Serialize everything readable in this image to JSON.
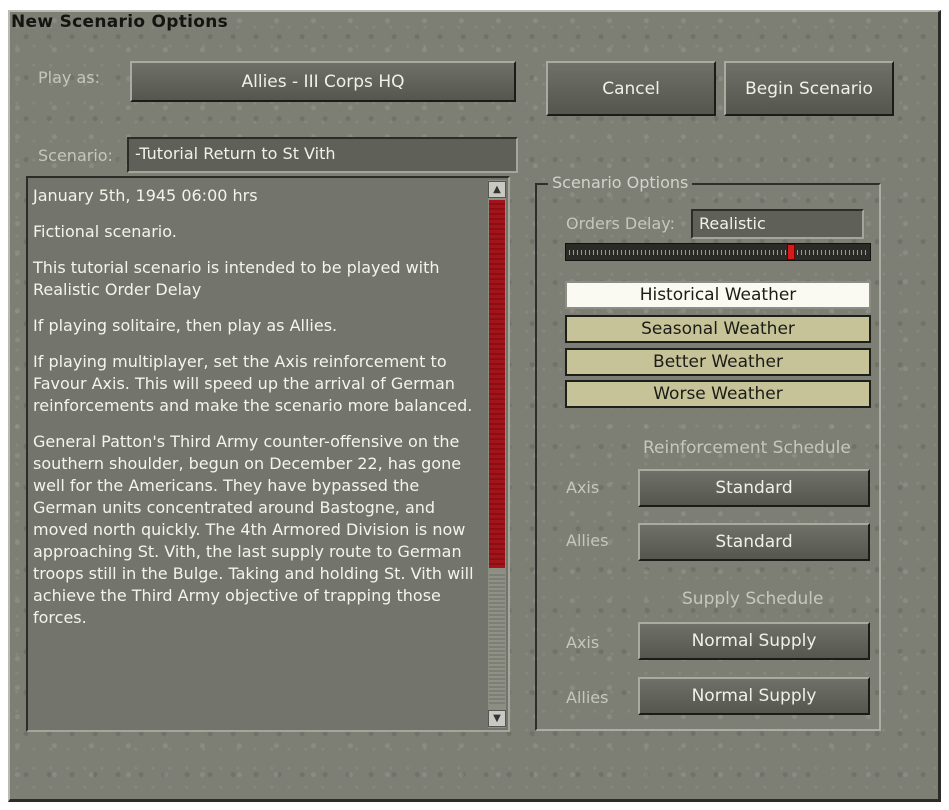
{
  "dialog": {
    "title": "New Scenario Options",
    "play_as_label": "Play as:",
    "play_as_value": "Allies - III Corps HQ",
    "cancel_label": "Cancel",
    "begin_label": "Begin Scenario",
    "scenario_label": "Scenario:",
    "scenario_value": "-Tutorial Return to St Vith"
  },
  "description": {
    "paragraphs": [
      "January 5th, 1945 06:00 hrs",
      "Fictional scenario.",
      "This tutorial scenario is intended to be played with Realistic Order Delay",
      "If playing solitaire, then play as Allies.",
      "If playing multiplayer, set the Axis reinforcement to Favour Axis. This will speed up the arrival of German reinforcements and make the scenario more balanced.",
      "General Patton's Third Army counter-offensive on the southern shoulder, begun on December 22, has gone well for the Americans. They have bypassed the German units concentrated around Bastogne, and moved north quickly. The 4th Armored Division is now approaching St. Vith, the last supply route to German troops still in the Bulge. Taking and holding St. Vith will achieve the Third Army objective of trapping those forces."
    ]
  },
  "options": {
    "group_title": "Scenario Options",
    "orders_delay_label": "Orders Delay:",
    "orders_delay_value": "Realistic",
    "orders_delay_level": 0.74,
    "weather": [
      {
        "label": "Historical Weather",
        "selected": true
      },
      {
        "label": "Seasonal Weather",
        "selected": false
      },
      {
        "label": "Better Weather",
        "selected": false
      },
      {
        "label": "Worse Weather",
        "selected": false
      }
    ],
    "reinforcement_title": "Reinforcement Schedule",
    "reinforcement": {
      "axis_label": "Axis",
      "axis_value": "Standard",
      "allies_label": "Allies",
      "allies_value": "Standard"
    },
    "supply_title": "Supply Schedule",
    "supply": {
      "axis_label": "Axis",
      "axis_value": "Normal Supply",
      "allies_label": "Allies",
      "allies_value": "Normal Supply"
    }
  },
  "colors": {
    "panel": "#7d7f75",
    "scrollbar_thumb": "#a3141a",
    "weather_selected": "#fafaf2",
    "weather_unselected": "#c6c398",
    "slider_knob": "#d51a1a"
  },
  "icons": {
    "scroll_up": "arrow-up-icon",
    "scroll_down": "arrow-down-icon"
  }
}
